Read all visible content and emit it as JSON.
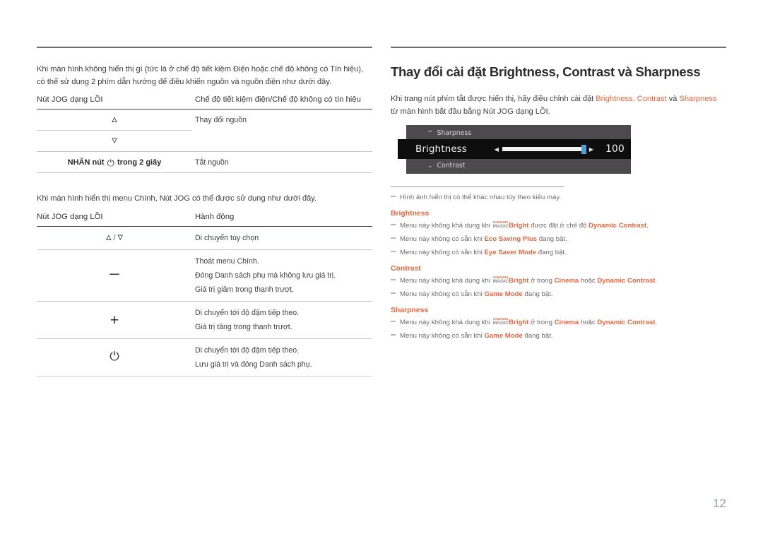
{
  "left_column": {
    "intro_paragraph": "Khi màn hình không hiển thị gì (tức là ở chế độ tiết kiệm Điện hoặc chế độ không có Tín hiệu), có thể sử dụng 2 phím dẫn hướng để điều khiển nguồn và nguồn điện như dưới đây.",
    "table1": {
      "headers": [
        "Nút JOG dạng LỒI",
        "Chế độ tiết kiệm điện/Chế độ không có tín hiệu"
      ],
      "rows": [
        {
          "key_icon": "chevron-up-icon",
          "key_text": "",
          "value": "Thay đổi nguồn"
        },
        {
          "key_icon": "chevron-down-icon",
          "key_text": "",
          "value": ""
        },
        {
          "key_icon": "power-icon",
          "key_text_before": "NHẤN nút",
          "key_text_after": "trong 2 giây",
          "value": "Tắt nguồn"
        }
      ]
    },
    "intro_paragraph2": "Khi màn hình hiển thị menu Chính, Nút JOG có thể được sử dụng như dưới đây.",
    "table2": {
      "headers": [
        "Nút JOG dạng LỒI",
        "Hành động"
      ],
      "rows": [
        {
          "key_icon": "chevron-up-down-icon",
          "lines": [
            "Di chuyển tùy chọn"
          ]
        },
        {
          "key_icon": "minus-icon",
          "lines": [
            "Thoát menu Chính.",
            "Đóng Danh sách phụ mà không lưu giá trị.",
            "Giá trị giảm trong thanh trượt."
          ]
        },
        {
          "key_icon": "plus-icon",
          "lines": [
            "Di chuyển tới độ đậm tiếp theo.",
            "Giá trị tăng trong thanh trượt."
          ]
        },
        {
          "key_icon": "power-icon",
          "lines": [
            "Di chuyển tới độ đậm tiếp theo.",
            "Lưu giá trị và đóng Danh sách phụ."
          ]
        }
      ]
    }
  },
  "right_column": {
    "section_title": "Thay đổi cài đặt Brightness, Contrast và Sharpness",
    "intro": {
      "part1": "Khi trang nút phím tắt được hiển thị, hãy điều chỉnh cài đặt ",
      "kw1": "Brightness, Contrast",
      "part2": " và ",
      "kw2": "Sharpness",
      "part3": " từ màn hình bắt đầu bằng Nút JOG dạng LỒI."
    },
    "osd": {
      "top_item": "Sharpness",
      "top_icon": "chevron-up-icon",
      "active_item": "Brightness",
      "bottom_item": "Contrast",
      "bottom_icon": "chevron-down-icon",
      "left_arrow": "◀",
      "right_arrow": "▶",
      "value": "100",
      "slider_percent": 100,
      "panel_bg": "#4c4a4c",
      "active_bg": "#0e0e0e",
      "thumb_color": "#4e9ede"
    },
    "general_note": "Hình ảnh hiển thị có thể khác nhau tùy theo kiểu máy.",
    "note_groups": [
      {
        "heading": "Brightness",
        "notes": [
          {
            "prefix": "Menu này không khả dụng khi ",
            "magic_logo": {
              "line1": "SAMSUNG",
              "line2": "MAGIC"
            },
            "magic_word": "Bright",
            "middle": " được đặt ở chế độ ",
            "em1": "Dynamic Contrast",
            "suffix": "."
          },
          {
            "prefix": "Menu này không có sẵn khi ",
            "em1": "Eco Saving Plus",
            "suffix": " đang bật."
          },
          {
            "prefix": "Menu này không có sẵn khi ",
            "em1": "Eye Saver Mode",
            "suffix": " đang bật."
          }
        ]
      },
      {
        "heading": "Contrast",
        "notes": [
          {
            "prefix": "Menu này không khả dụng khi ",
            "magic_logo": {
              "line1": "SAMSUNG",
              "line2": "MAGIC"
            },
            "magic_word": "Bright",
            "middle": " ở trong ",
            "em1": "Cinema",
            "middle2": " hoặc ",
            "em2": "Dynamic Contrast",
            "suffix": "."
          },
          {
            "prefix": "Menu này không có sẵn khi ",
            "em1": "Game Mode",
            "suffix": " đang bật."
          }
        ]
      },
      {
        "heading": "Sharpness",
        "notes": [
          {
            "prefix": "Menu này không khả dụng khi ",
            "magic_logo": {
              "line1": "SAMSUNG",
              "line2": "MAGIC"
            },
            "magic_word": "Bright",
            "middle": " ở trong ",
            "em1": "Cinema",
            "middle2": " hoặc ",
            "em2": "Dynamic Contrast",
            "suffix": "."
          },
          {
            "prefix": "Menu này không có sẵn khi ",
            "em1": "Game Mode",
            "suffix": " đang bật."
          }
        ]
      }
    ]
  },
  "footer": {
    "page_number": "12"
  },
  "colors": {
    "accent_orange": "#e0673f",
    "rule_dark": "#6f6f6f",
    "rule_light": "#c8c8c8",
    "rule_pink": "#e4c9d6",
    "page_number": "#9aa0a3"
  }
}
